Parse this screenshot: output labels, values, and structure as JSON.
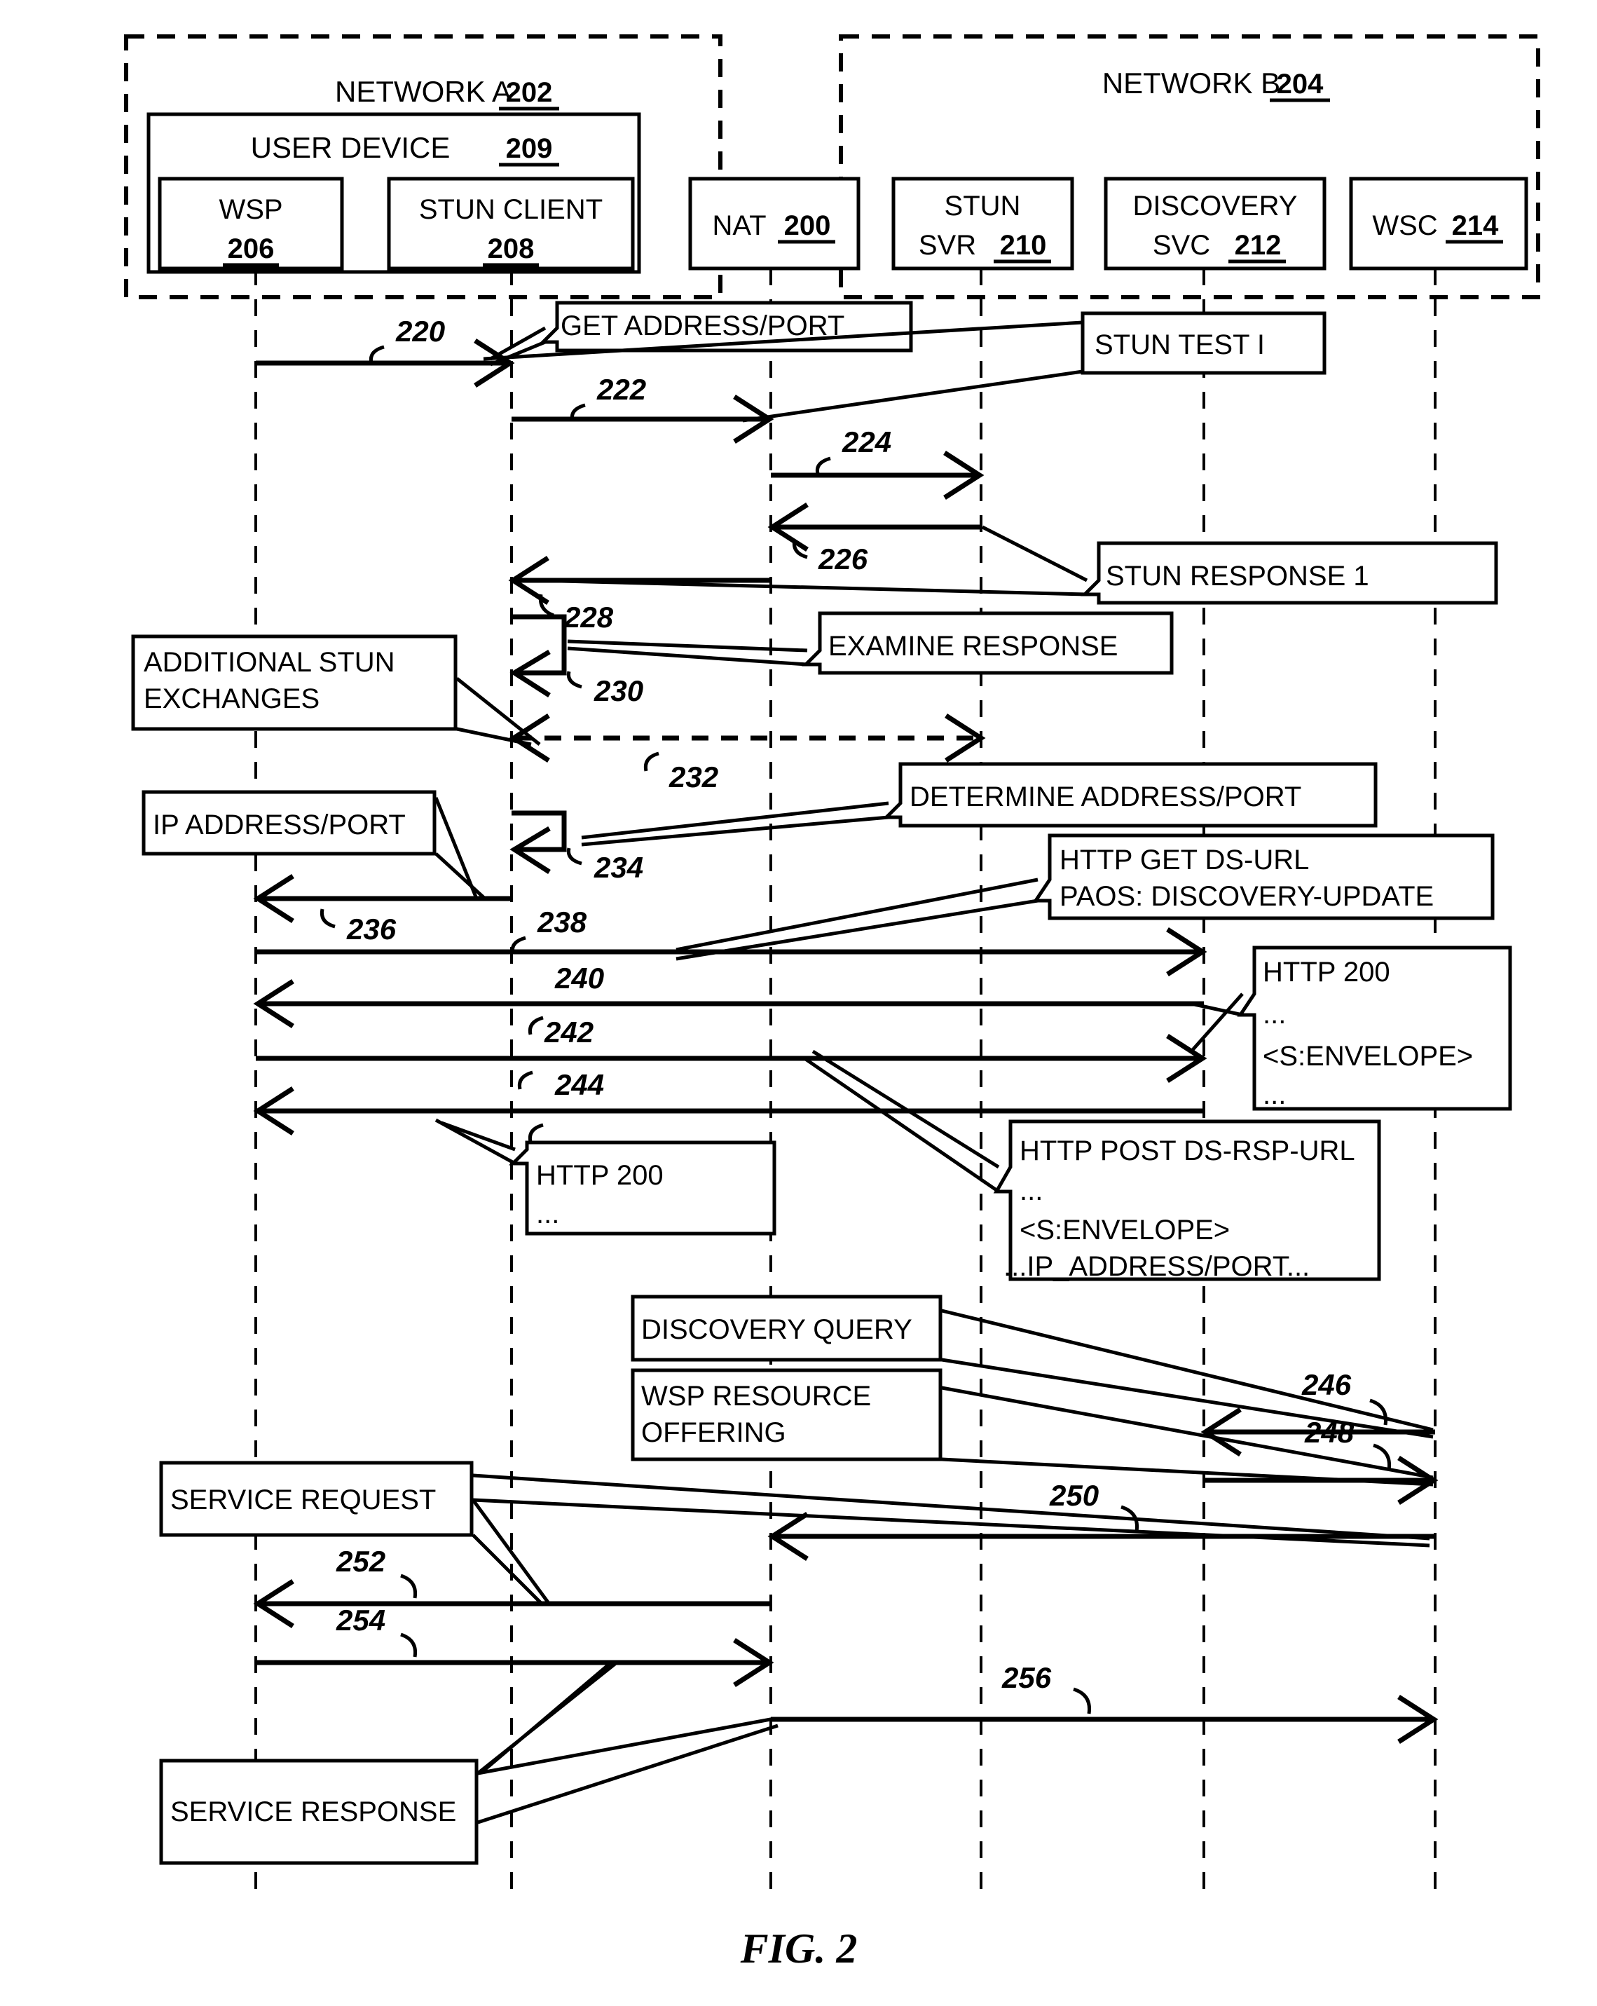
{
  "figure": {
    "caption": "FIG. 2"
  },
  "networks": [
    {
      "name": "network-a",
      "title": "NETWORK A",
      "ref": "202"
    },
    {
      "name": "network-b",
      "title": "NETWORK B",
      "ref": "204"
    }
  ],
  "user_device": {
    "title": "USER DEVICE",
    "ref": "209"
  },
  "lifelines": [
    {
      "name": "wsp",
      "label": "WSP",
      "ref": "206",
      "two_line": true
    },
    {
      "name": "stun-client",
      "label": "STUN CLIENT",
      "ref": "208",
      "two_line": true
    },
    {
      "name": "nat",
      "label": "NAT",
      "ref": "200",
      "two_line": false
    },
    {
      "name": "stun-svr",
      "label": "STUN",
      "label2": "SVR",
      "ref": "210",
      "two_line": true
    },
    {
      "name": "discovery-svc",
      "label": "DISCOVERY",
      "label2": "SVC",
      "ref": "212",
      "two_line": true
    },
    {
      "name": "wsc",
      "label": "WSC",
      "ref": "214",
      "two_line": false
    }
  ],
  "callouts": [
    {
      "name": "callout-get-address-port",
      "lines": [
        "GET ADDRESS/PORT"
      ]
    },
    {
      "name": "callout-stun-test-1",
      "lines": [
        "STUN TEST I"
      ]
    },
    {
      "name": "callout-stun-response-1",
      "lines": [
        "STUN RESPONSE 1"
      ]
    },
    {
      "name": "callout-examine-response",
      "lines": [
        "EXAMINE RESPONSE"
      ]
    },
    {
      "name": "callout-additional-stun-exchanges",
      "lines": [
        "ADDITIONAL STUN",
        "EXCHANGES"
      ]
    },
    {
      "name": "callout-determine-address-port",
      "lines": [
        "DETERMINE ADDRESS/PORT"
      ]
    },
    {
      "name": "callout-ip-address-port",
      "lines": [
        "IP ADDRESS/PORT"
      ]
    },
    {
      "name": "callout-http-get-ds-url",
      "lines": [
        "HTTP GET DS-URL",
        "PAOS: DISCOVERY-UPDATE"
      ]
    },
    {
      "name": "callout-http-200-envelope",
      "lines": [
        "HTTP 200",
        "...",
        "<S:ENVELOPE>",
        "..."
      ]
    },
    {
      "name": "callout-http-200-left",
      "lines": [
        "HTTP 200",
        "..."
      ]
    },
    {
      "name": "callout-http-post-ds-rsp-url",
      "lines": [
        "HTTP POST DS-RSP-URL",
        "...",
        "<S:ENVELOPE>",
        "...IP_ADDRESS/PORT..."
      ]
    },
    {
      "name": "callout-discovery-query",
      "lines": [
        "DISCOVERY QUERY"
      ]
    },
    {
      "name": "callout-wsp-resource-offering",
      "lines": [
        "WSP RESOURCE",
        "OFFERING"
      ]
    },
    {
      "name": "callout-service-request",
      "lines": [
        "SERVICE REQUEST"
      ]
    },
    {
      "name": "callout-service-response",
      "lines": [
        "SERVICE RESPONSE"
      ]
    }
  ],
  "message_numbers": [
    {
      "name": "msg-220",
      "value": "220"
    },
    {
      "name": "msg-222",
      "value": "222"
    },
    {
      "name": "msg-224",
      "value": "224"
    },
    {
      "name": "msg-226",
      "value": "226"
    },
    {
      "name": "msg-228",
      "value": "228"
    },
    {
      "name": "msg-230",
      "value": "230"
    },
    {
      "name": "msg-232",
      "value": "232"
    },
    {
      "name": "msg-234",
      "value": "234"
    },
    {
      "name": "msg-236",
      "value": "236"
    },
    {
      "name": "msg-238",
      "value": "238"
    },
    {
      "name": "msg-240",
      "value": "240"
    },
    {
      "name": "msg-242",
      "value": "242"
    },
    {
      "name": "msg-244",
      "value": "244"
    },
    {
      "name": "msg-246",
      "value": "246"
    },
    {
      "name": "msg-248",
      "value": "248"
    },
    {
      "name": "msg-250",
      "value": "250"
    },
    {
      "name": "msg-252",
      "value": "252"
    },
    {
      "name": "msg-254",
      "value": "254"
    },
    {
      "name": "msg-256",
      "value": "256"
    }
  ]
}
